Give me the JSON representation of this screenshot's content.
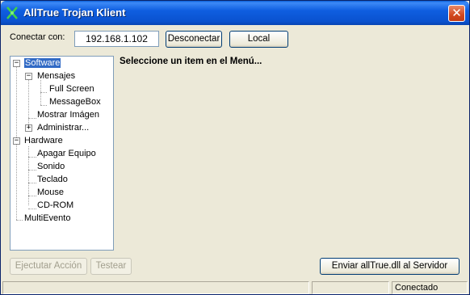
{
  "window": {
    "title": "AllTrue Trojan Klient",
    "close_glyph": "✕",
    "icon": "trojan-app-icon"
  },
  "connection": {
    "label": "Conectar con:",
    "ip_value": "192.168.1.102",
    "disconnect_label": "Desconectar",
    "local_label": "Local"
  },
  "tree": {
    "nodes": [
      {
        "label": "Software",
        "expander": "−"
      },
      {
        "label": "Mensajes",
        "expander": "−"
      },
      {
        "label": "Full Screen"
      },
      {
        "label": "MessageBox"
      },
      {
        "label": "Mostrar Imágen"
      },
      {
        "label": "Administrar...",
        "expander": "+"
      },
      {
        "label": "Hardware",
        "expander": "−"
      },
      {
        "label": "Apagar Equipo"
      },
      {
        "label": "Sonido"
      },
      {
        "label": "Teclado"
      },
      {
        "label": "Mouse"
      },
      {
        "label": "CD-ROM"
      },
      {
        "label": "MultiEvento"
      }
    ]
  },
  "main": {
    "message": "Seleccione un item en el Menú..."
  },
  "actions": {
    "execute_label": "Ejectutar Acción",
    "test_label": "Testear",
    "send_dll_label": "Enviar allTrue.dll al Servidor"
  },
  "status": {
    "pane1": "",
    "pane2": "",
    "pane3": "Conectado"
  },
  "colors": {
    "titlebar": "#0a52cf",
    "selection": "#316ac5",
    "window_bg": "#ece9d8"
  }
}
